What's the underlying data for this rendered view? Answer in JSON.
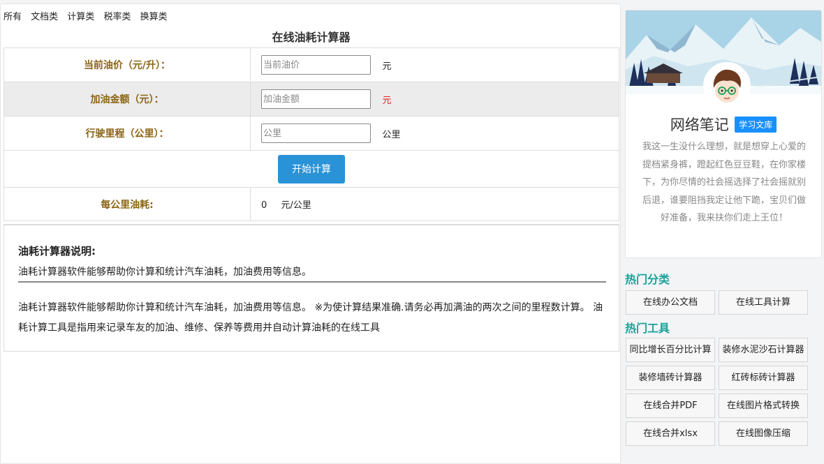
{
  "nav": [
    "所有",
    "文档类",
    "计算类",
    "税率类",
    "换算类"
  ],
  "title": "在线油耗计算器",
  "form": {
    "price_label": "当前油价（元/升）：",
    "price_placeholder": "当前油价",
    "price_unit": "元",
    "amount_label": "加油金额（元）：",
    "amount_placeholder": "加油金额",
    "amount_unit": "元",
    "distance_label": "行驶里程（公里）：",
    "distance_placeholder": "公里",
    "distance_unit": "公里",
    "calc_button": "开始计算",
    "result_label": "每公里油耗:",
    "result_value": "0",
    "result_unit": "元/公里"
  },
  "description": {
    "heading": "油耗计算器说明:",
    "subtitle": "油耗计算器软件能够帮助你计算和统计汽车油耗，加油费用等信息。",
    "body": "油耗计算器软件能够帮助你计算和统计汽车油耗，加油费用等信息。 ※为使计算结果准确.请务必再加满油的两次之间的里程数计算。 油耗计算工具是指用来记录车友的加油、维修、保养等费用并自动计算油耗的在线工具"
  },
  "profile": {
    "name": "网络笔记",
    "badge": "学习文库",
    "bio": "我这一生没什么理想，就是想穿上心爱的提档紧身裤，蹬起红色豆豆鞋，在你家楼下，为你尽情的社会摇选择了社会摇就别后退，谁要阻挡我定让他下跪，宝贝们做好准备，我来扶你们走上王位！"
  },
  "hot_categories": {
    "title": "热门分类",
    "items": [
      "在线办公文档",
      "在线工具计算"
    ]
  },
  "hot_tools": {
    "title": "热门工具",
    "items": [
      "同比增长百分比计算",
      "装修水泥沙石计算器",
      "装修墙砖计算器",
      "红砖标砖计算器",
      "在线合并PDF",
      "在线图片格式转换",
      "在线合并xlsx",
      "在线图像压缩"
    ]
  },
  "colors": {
    "label_gold": "#8a6414",
    "button_blue": "#2a93d8",
    "section_teal": "#1aa198",
    "badge_blue": "#1890ff",
    "unit_red": "#e02020"
  }
}
